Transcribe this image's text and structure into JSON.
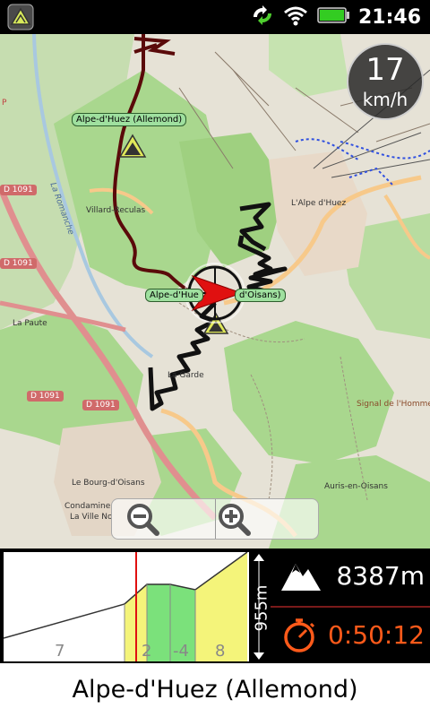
{
  "status_bar": {
    "time": "21:46",
    "icons": [
      "app-route-icon",
      "sync-icon",
      "wifi-icon",
      "battery-icon"
    ]
  },
  "map": {
    "labels": {
      "allemond_tag": "Alpe-d'Huez (Allemond)",
      "oisans_tag_left": "Alpe-d'Hue",
      "oisans_tag_right": "d'Oisans)",
      "villard": "Villard-Reculas",
      "romanche": "La Romanche",
      "lalpe": "L'Alpe d'Huez",
      "la_paute": "La Paute",
      "la_garde": "La Garde",
      "signal": "Signal de l'Homme",
      "bourg": "Le Bourg-d'Oisans",
      "condamine": "Condamine",
      "ville_no": "La Ville No",
      "auris": "Auris-en-Oisans",
      "p": "P"
    },
    "road_shields": [
      "D 1091",
      "D 1091",
      "D 1091",
      "D 1091"
    ],
    "colors": {
      "route": "#5a0a0a",
      "forest": "#a9d78e",
      "road_main": "#e08f8f",
      "road_secondary": "#f7c98a"
    }
  },
  "speed": {
    "value": "17",
    "unit": "km/h"
  },
  "zoom": {
    "out_icon": "zoom-out-icon",
    "in_icon": "zoom-in-icon"
  },
  "elevation_profile": {
    "range_label": "955m",
    "grade_labels": [
      "7",
      "2",
      "-4",
      "8"
    ],
    "colors": {
      "steep": "#f4f47a",
      "flat": "#7be17b",
      "marker": "#e01010"
    }
  },
  "stats": {
    "distance": "8387m",
    "time": "0:50:12",
    "colors": {
      "distance": "#ffffff",
      "time": "#ff5a1a"
    }
  },
  "footer": {
    "title": "Alpe-d'Huez (Allemond)"
  }
}
